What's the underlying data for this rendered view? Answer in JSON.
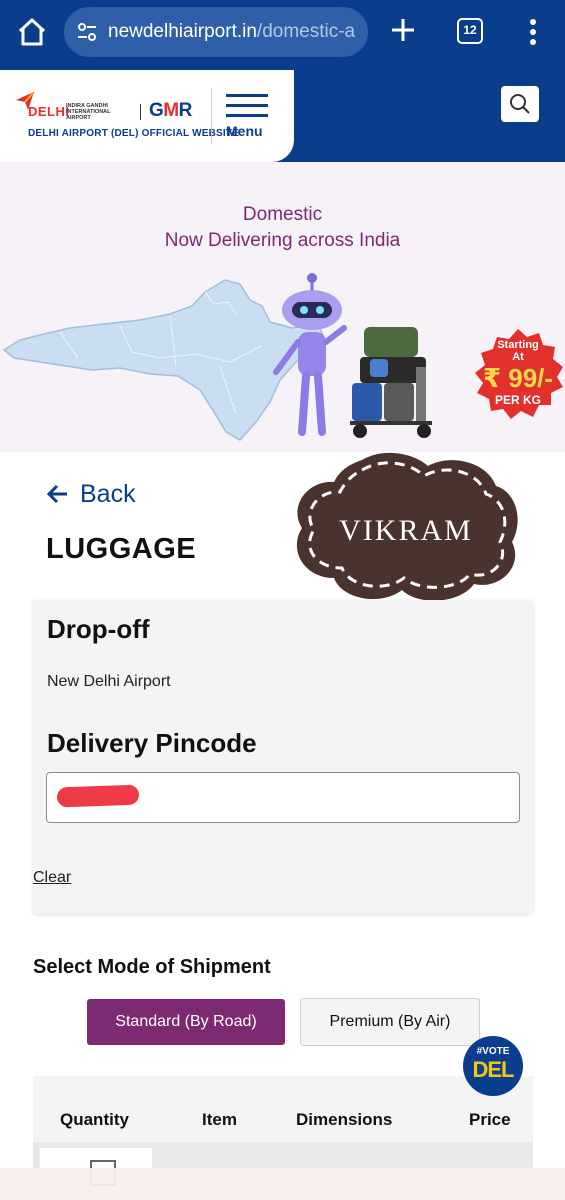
{
  "browser": {
    "url_host": "newdelhiairport.in",
    "url_path": "/domestic-a",
    "tab_count": "12"
  },
  "header": {
    "logo_delhi": "DELHI",
    "logo_igi": "INDIRA GANDHI INTERNATIONAL AIRPORT",
    "logo_gmr_left": "G",
    "logo_gmr_mid": "M",
    "logo_gmr_right": "R",
    "logo_subtitle": "DELHI AIRPORT (DEL) OFFICIAL WEBSITE",
    "menu_label": "Menu"
  },
  "banner": {
    "line1": "Domestic",
    "line2": "Now Delivering across India",
    "badge_top": "Starting",
    "badge_at": "At",
    "badge_price": "₹ 99/-",
    "badge_unit": "PER KG"
  },
  "page": {
    "back_label": "Back",
    "title": "LUGGAGE",
    "sticker_text": "VIKRAM"
  },
  "form": {
    "dropoff_heading": "Drop-off",
    "dropoff_value": "New Delhi Airport",
    "pincode_heading": "Delivery Pincode",
    "pincode_value": "",
    "clear_label": "Clear"
  },
  "shipment": {
    "title": "Select Mode of Shipment",
    "options": [
      "Standard (By Road)",
      "Premium (By Air)"
    ],
    "selected": "Standard (By Road)"
  },
  "vote_badge": {
    "line1": "#VOTE",
    "line2": "DEL"
  },
  "table": {
    "headers": [
      "Quantity",
      "Item",
      "Dimensions",
      "Price"
    ]
  },
  "colors": {
    "brand_blue": "#0a3e8c",
    "accent_purple": "#7e2a72",
    "badge_red": "#e2312d"
  }
}
